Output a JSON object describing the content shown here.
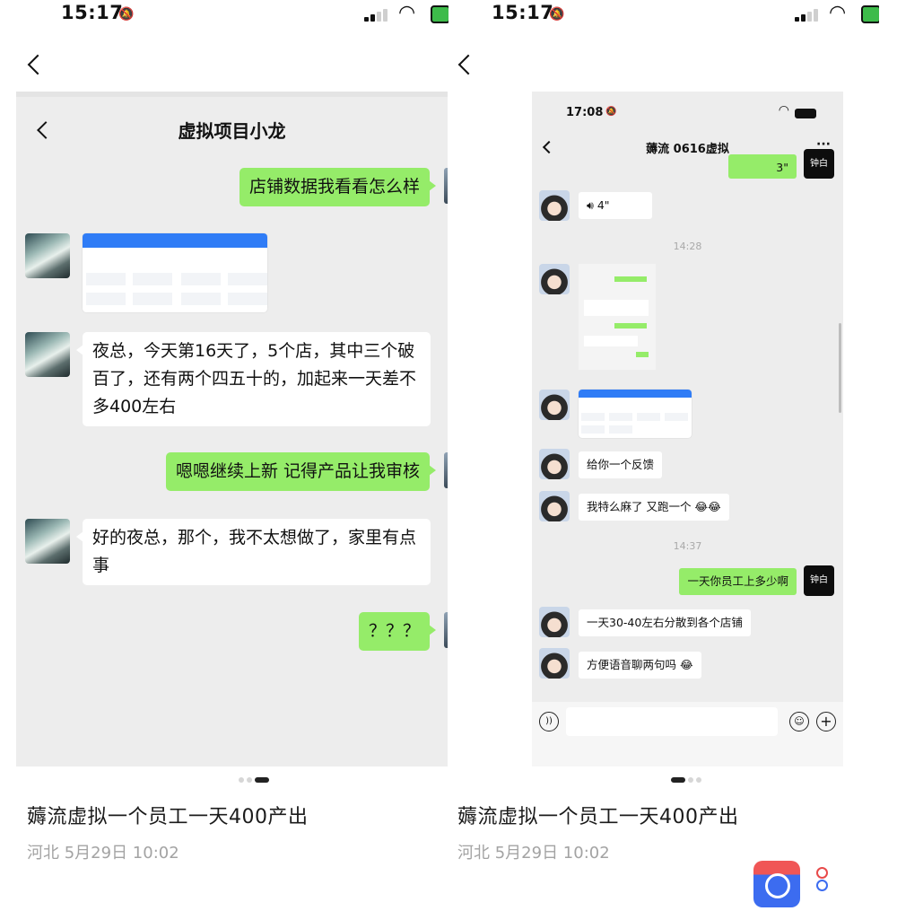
{
  "status_bar": {
    "time": "15:17"
  },
  "left_panel": {
    "chat_title": "虚拟项目小龙",
    "messages": [
      "店铺数据我看看怎么样",
      "夜总，今天第16天了，5个店，其中三个破百了，还有两个四五十的，加起来一天差不多400左右",
      "嗯嗯继续上新  记得产品让我审核",
      "好的夜总，那个，我不太想做了，家里有点事",
      "？？？"
    ],
    "caption": "薅流虚拟一个员工一天400产出",
    "meta": "河北  5月29日  10:02"
  },
  "right_panel": {
    "inner_time": "17:08",
    "chat_title": "薅流 0616虚拟",
    "voice_top": "3\"",
    "voice_msg": "4\"",
    "time_1": "14:28",
    "time_2": "14:37",
    "messages": [
      "给你一个反馈",
      "我特么麻了 又跑一个",
      "一天你员工上多少啊",
      "一天30-40左右分散到各个店铺",
      "方便语音聊两句吗"
    ],
    "dark_avatar_text": "钟白",
    "caption": "薅流虚拟一个员工一天400产出",
    "meta": "河北  5月29日  10:02"
  }
}
